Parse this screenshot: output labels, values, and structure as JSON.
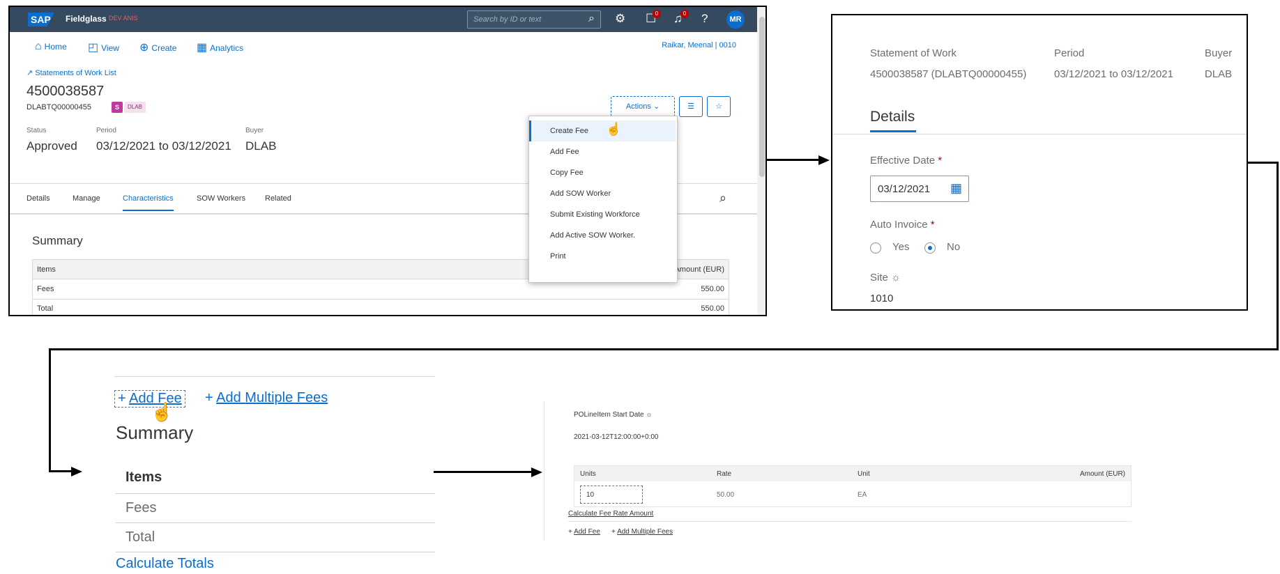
{
  "panel1": {
    "shell": {
      "brand": "SAP",
      "app_name": "Fieldglass",
      "env_label": "DEV ANIS",
      "search_placeholder": "Search by ID or text",
      "notif_count_1": "0",
      "notif_count_2": "0",
      "user_initials": "MR"
    },
    "nav": {
      "home": "Home",
      "view": "View",
      "create": "Create",
      "analytics": "Analytics",
      "user": "Raikar, Meenal | 0010"
    },
    "breadcrumb": "Statements of Work List",
    "title": "4500038587",
    "subtitle_id": "DLABTQ00000455",
    "tag_letter": "S",
    "tag_label": "DLAB",
    "fields": {
      "status_label": "Status",
      "status_value": "Approved",
      "period_label": "Period",
      "period_value": "03/12/2021 to 03/12/2021",
      "buyer_label": "Buyer",
      "buyer_value": "DLAB"
    },
    "actions_label": "Actions",
    "menu": [
      "Create Fee",
      "Add Fee",
      "Copy Fee",
      "Add SOW Worker",
      "Submit Existing Workforce",
      "Add Active SOW Worker.",
      "Print"
    ],
    "tabs": [
      "Details",
      "Manage",
      "Characteristics",
      "SOW Workers",
      "Related"
    ],
    "summary": {
      "title": "Summary",
      "col_items": "Items",
      "col_amount": "Amount (EUR)",
      "rows": [
        {
          "item": "Fees",
          "amount": "550.00"
        },
        {
          "item": "Total",
          "amount": "550.00"
        }
      ]
    }
  },
  "panel2": {
    "sow_label": "Statement of Work",
    "sow_value": "4500038587 (DLABTQ00000455)",
    "period_label": "Period",
    "period_value": "03/12/2021 to 03/12/2021",
    "buyer_label": "Buyer",
    "buyer_value": "DLAB",
    "section_title": "Details",
    "effective_date_label": "Effective Date",
    "required_marker": "*",
    "effective_date_value": "03/12/2021",
    "auto_invoice_label": "Auto Invoice",
    "yes_label": "Yes",
    "no_label": "No",
    "site_label": "Site",
    "site_value": "1010"
  },
  "panel3": {
    "add_fee": "Add Fee",
    "add_multiple_fees": "Add Multiple Fees",
    "summary_title": "Summary",
    "items_header": "Items",
    "rows": [
      "Fees",
      "Total"
    ],
    "calc_totals": "Calculate Totals"
  },
  "panel4": {
    "start_date_label": "POLineItem Start Date",
    "start_date_value": "2021-03-12T12:00:00+0:00",
    "headers": [
      "Units",
      "Rate",
      "Unit",
      "Amount (EUR)"
    ],
    "units_value": "10",
    "rate_value": "50.00",
    "unit_value": "EA",
    "calc_link": "Calculate Fee Rate Amount",
    "add_fee": "Add Fee",
    "add_multiple_fees": "Add Multiple Fees"
  },
  "colors": {
    "accent": "#0a6ed1",
    "shell": "#354a5f",
    "tag": "#c0399f",
    "required": "#bb0000"
  }
}
